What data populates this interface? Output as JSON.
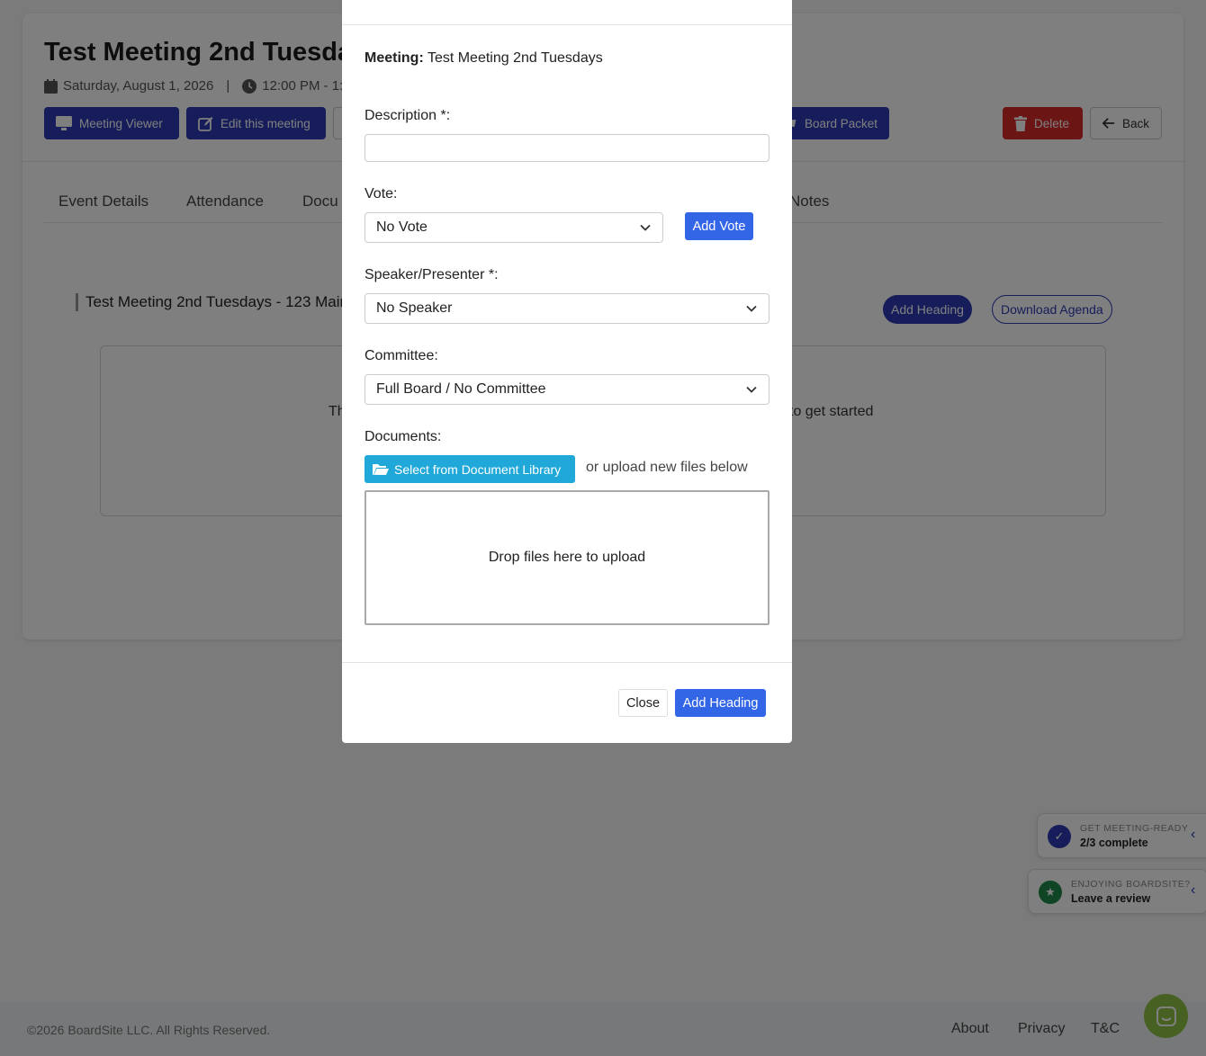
{
  "page": {
    "title": "Test Meeting 2nd Tuesdays",
    "date": "Saturday, August 1, 2026",
    "meta_separator": "|",
    "time": "12:00 PM - 1:",
    "buttons": {
      "meeting_viewer": "Meeting Viewer",
      "edit_meeting": "Edit this meeting",
      "board_packet": "Board Packet",
      "delete": "Delete",
      "back": "Back"
    },
    "tabs": [
      "Event Details",
      "Attendance",
      "Docu",
      "Notes"
    ],
    "agenda": {
      "title": "Test Meeting 2nd Tuesdays - 123 Main",
      "add_heading": "Add Heading",
      "download_agenda": "Download Agenda",
      "empty_left": "Th",
      "empty_right": "to get started"
    }
  },
  "modal": {
    "meeting_label": "Meeting:",
    "meeting_value": "Test Meeting 2nd Tuesdays",
    "description_label": "Description *:",
    "description_value": "",
    "vote_label": "Vote:",
    "vote_selected": "No Vote",
    "add_vote": "Add Vote",
    "speaker_label": "Speaker/Presenter *:",
    "speaker_selected": "No Speaker",
    "committee_label": "Committee:",
    "committee_selected": "Full Board / No Committee",
    "documents_label": "Documents:",
    "select_library": "Select from Document Library",
    "or_upload": "or upload new files below",
    "dropzone": "Drop files here to upload",
    "close": "Close",
    "add_heading": "Add Heading"
  },
  "widgets": {
    "meeting_ready_small": "GET MEETING-READY",
    "meeting_ready_big": "2/3 complete",
    "review_small": "ENJOYING BOARDSITE?",
    "review_big": "Leave a review"
  },
  "footer": {
    "copyright": "©2026 BoardSite LLC. All Rights Reserved.",
    "links": [
      "About",
      "Privacy",
      "T&C"
    ]
  },
  "colors": {
    "navy": "#2d3bb5",
    "danger": "#d92b2b",
    "primary": "#3366e6",
    "info": "#1fa8d8",
    "chat": "#8fc344"
  }
}
